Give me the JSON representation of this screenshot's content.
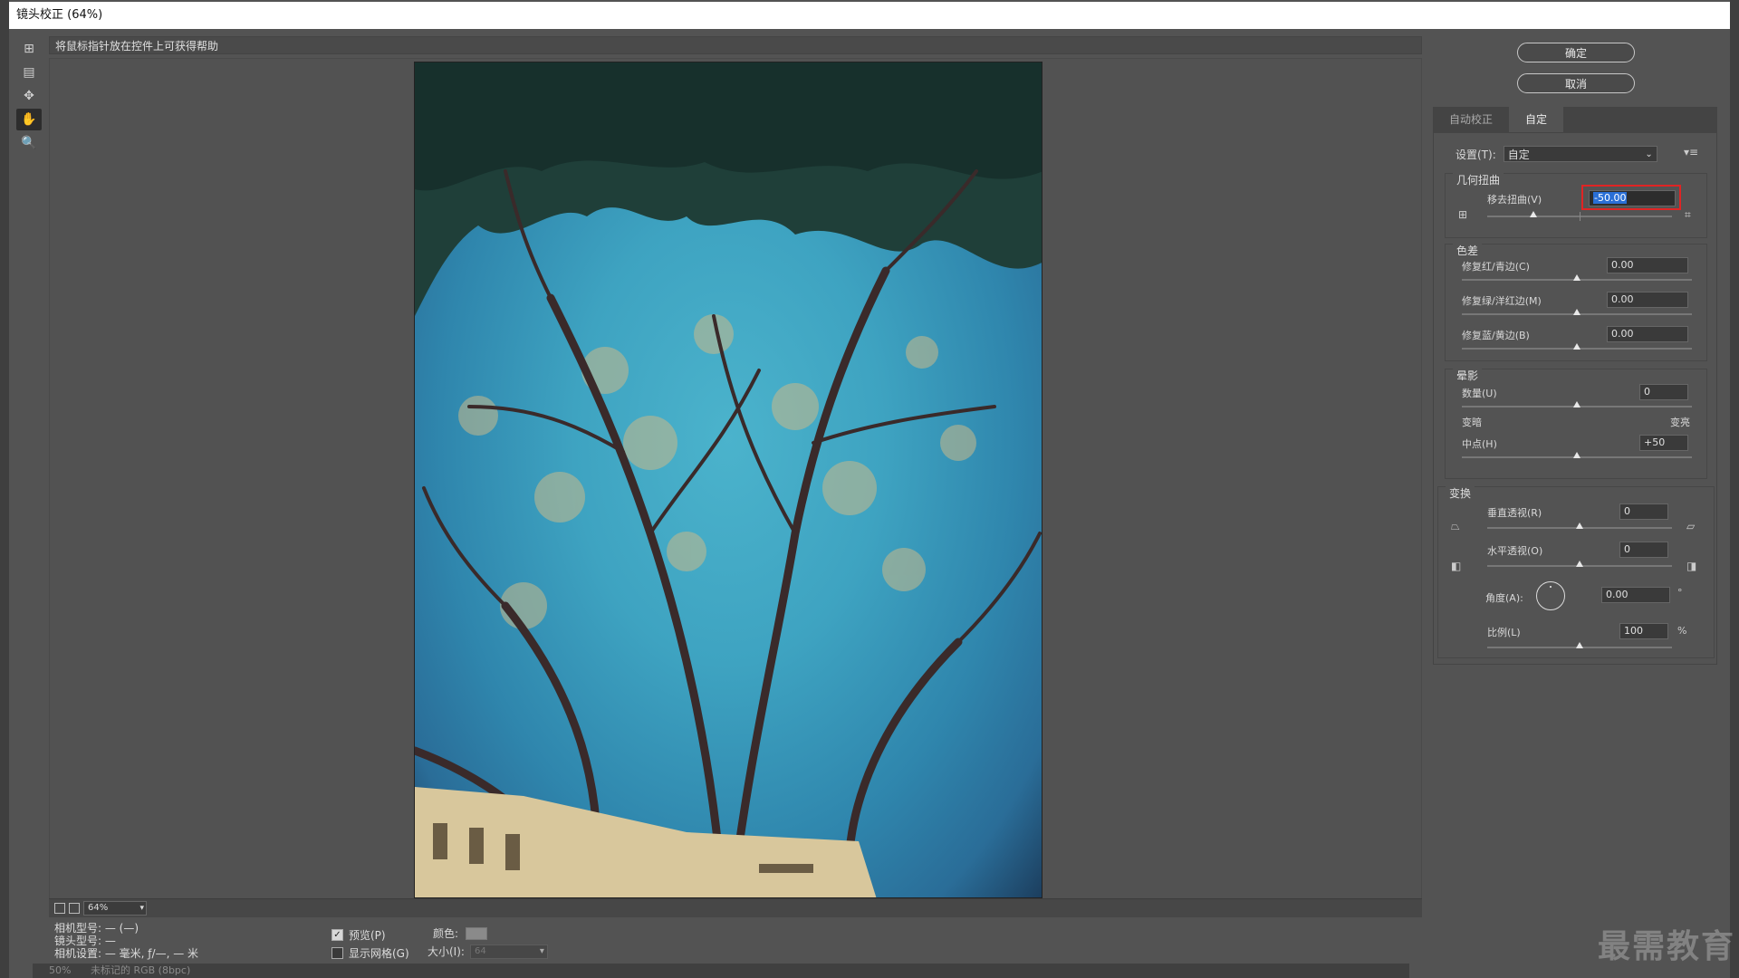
{
  "window": {
    "title": "镜头校正 (64%)"
  },
  "help_text": "将鼠标指针放在控件上可获得帮助",
  "tools": [
    {
      "name": "remove-distortion-tool",
      "glyph": "⊞"
    },
    {
      "name": "straighten-tool",
      "glyph": "▤"
    },
    {
      "name": "move-grid-tool",
      "glyph": "✥"
    },
    {
      "name": "hand-tool",
      "glyph": "✋"
    },
    {
      "name": "zoom-tool",
      "glyph": "🔍"
    }
  ],
  "buttons": {
    "ok": "确定",
    "cancel": "取消"
  },
  "tabs": {
    "auto": "自动校正",
    "custom": "自定"
  },
  "settings": {
    "label": "设置(T):",
    "value": "自定"
  },
  "geometric": {
    "title": "几何扭曲",
    "remove_distortion_label": "移去扭曲(V)",
    "remove_distortion_value": "-50.00",
    "remove_distortion_fraction": 0.25
  },
  "chromatic": {
    "title": "色差",
    "red_cyan_label": "修复红/青边(C)",
    "red_cyan_value": "0.00",
    "green_magenta_label": "修复绿/洋红边(M)",
    "green_magenta_value": "0.00",
    "blue_yellow_label": "修复蓝/黄边(B)",
    "blue_yellow_value": "0.00"
  },
  "vignette": {
    "title": "晕影",
    "amount_label": "数量(U)",
    "amount_value": "0",
    "darken_label": "变暗",
    "lighten_label": "变亮",
    "midpoint_label": "中点(H)",
    "midpoint_value": "+50"
  },
  "transform": {
    "title": "变换",
    "vertical_label": "垂直透视(R)",
    "vertical_value": "0",
    "horizontal_label": "水平透视(O)",
    "horizontal_value": "0",
    "angle_label": "角度(A):",
    "angle_value": "0.00",
    "angle_unit": "°",
    "scale_label": "比例(L)",
    "scale_value": "100",
    "scale_unit": "%"
  },
  "zoom": {
    "value": "64%"
  },
  "camera_info": {
    "camera_model": "相机型号: — (—)",
    "lens_model": "镜头型号: —",
    "camera_settings": "相机设置: — 毫米, ƒ/—, — 米"
  },
  "options": {
    "preview_label": "预览(P)",
    "preview_checked": true,
    "show_grid_label": "显示网格(G)",
    "show_grid_checked": false,
    "color_label": "颜色:",
    "size_label": "大小(I):",
    "size_value": "64"
  },
  "bottom_status": {
    "zoom": "50%",
    "doc": "未标记的 RGB (8bpc)"
  },
  "watermark": "最需教育"
}
